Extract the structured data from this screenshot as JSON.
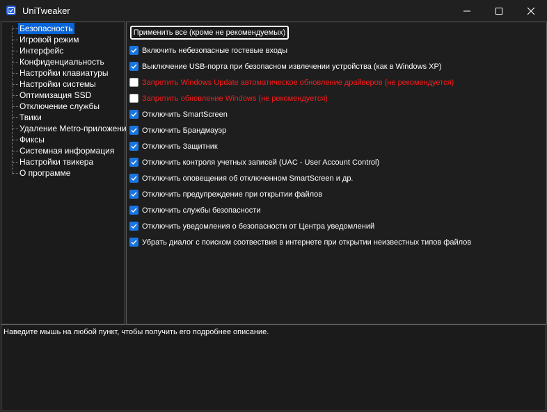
{
  "window": {
    "title": "UniTweaker",
    "icon": "check-square-icon",
    "controls": [
      "minimize-icon",
      "maximize-icon",
      "close-icon"
    ]
  },
  "sidebar": {
    "items": [
      {
        "label": "Безопасность",
        "selected": true
      },
      {
        "label": "Игровой режим"
      },
      {
        "label": "Интерфейс"
      },
      {
        "label": "Конфиденциальность"
      },
      {
        "label": "Настройки клавиатуры"
      },
      {
        "label": "Настройки системы"
      },
      {
        "label": "Оптимизация SSD"
      },
      {
        "label": "Отключение службы"
      },
      {
        "label": "Твики"
      },
      {
        "label": "Удаление Metro-приложений"
      },
      {
        "label": "Фиксы"
      },
      {
        "label": "Системная информация"
      },
      {
        "label": "Настройки твикера"
      },
      {
        "label": "О программе"
      }
    ]
  },
  "main": {
    "apply_button": "Применить все (кроме не рекомендуемых)",
    "options": [
      {
        "label": "Включить небезопасные гостевые входы",
        "checked": true
      },
      {
        "label": "Выключение USB-порта при безопасном извлечении устройства (как в Windows XP)",
        "checked": true
      },
      {
        "label": "Запретить Windows Update автоматическое обновление драйверов (не рекомендуется)",
        "checked": false,
        "warning": true
      },
      {
        "label": "Запретить обновление Windows (не рекомендуется)",
        "checked": false,
        "warning": true
      },
      {
        "label": "Отключить SmartScreen",
        "checked": true
      },
      {
        "label": "Отключить Брандмауэр",
        "checked": true
      },
      {
        "label": "Отключить Защитник",
        "checked": true
      },
      {
        "label": "Отключить контроля учетных записей (UAC - User Account Control)",
        "checked": true
      },
      {
        "label": "Отключить оповещения об отключенном SmartScreen и др.",
        "checked": true
      },
      {
        "label": "Отключить предупреждение при открытии файлов",
        "checked": true
      },
      {
        "label": "Отключить службы безопасности",
        "checked": true
      },
      {
        "label": "Отключить уведомления о безопасности от Центра уведомлений",
        "checked": true
      },
      {
        "label": "Убрать диалог с поиском соотвествия в интернете при открытии неизвестных типов файлов",
        "checked": true
      }
    ]
  },
  "description": {
    "text": "Наведите мышь на любой пункт, чтобы получить его подробнее описание."
  },
  "colors": {
    "accent": "#0a64d8",
    "checkbox": "#1976e0",
    "warning": "#ff1a1a",
    "background": "#202020"
  }
}
